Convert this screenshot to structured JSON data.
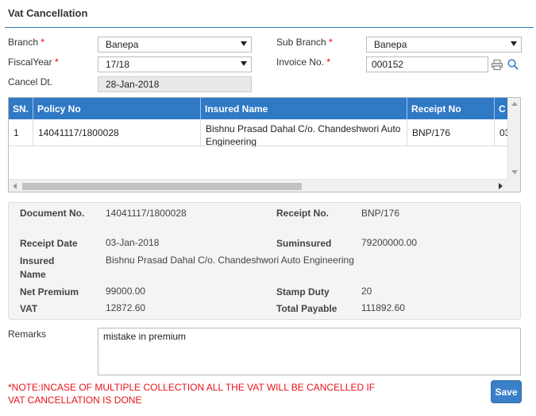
{
  "page": {
    "title": "Vat Cancellation"
  },
  "form": {
    "branch": {
      "label": "Branch",
      "required_mark": "*",
      "value": "Banepa"
    },
    "sub_branch": {
      "label": "Sub Branch",
      "required_mark": "*",
      "value": "Banepa"
    },
    "fiscal_year": {
      "label": "FiscalYear",
      "required_mark": "*",
      "value": "17/18"
    },
    "invoice_no": {
      "label": "Invoice No.",
      "required_mark": "*",
      "value": "000152"
    },
    "cancel_dt": {
      "label": "Cancel Dt.",
      "value": "28-Jan-2018"
    }
  },
  "grid": {
    "columns": [
      "SN.",
      "Policy No",
      "Insured Name",
      "Receipt No",
      "C"
    ],
    "rows": [
      {
        "sn": "1",
        "policy_no": "14041117/1800028",
        "insured_name": "Bishnu Prasad Dahal C/o. Chandeshwori Auto Engineering",
        "receipt_no": "BNP/176",
        "c": "03"
      }
    ]
  },
  "details": {
    "document_no": {
      "label": "Document No.",
      "value": "14041117/1800028"
    },
    "receipt_no": {
      "label": "Receipt No.",
      "value": "BNP/176"
    },
    "receipt_date": {
      "label": "Receipt Date",
      "value": "03-Jan-2018"
    },
    "suminsured": {
      "label": "Suminsured",
      "value": "79200000.00"
    },
    "insured_name": {
      "label": "Insured Name",
      "value": "Bishnu Prasad Dahal C/o. Chandeshwori Auto Engineering"
    },
    "net_premium": {
      "label": "Net Premium",
      "value": "99000.00"
    },
    "stamp_duty": {
      "label": "Stamp Duty",
      "value": "20"
    },
    "vat": {
      "label": "VAT",
      "value": "12872.60"
    },
    "total_payable": {
      "label": "Total Payable",
      "value": "111892.60"
    }
  },
  "remarks": {
    "label": "Remarks",
    "value": "mistake in premium"
  },
  "note": "*NOTE:INCASE OF MULTIPLE COLLECTION ALL THE VAT WILL BE CANCELLED IF VAT CANCELLATION IS DONE",
  "actions": {
    "save_label": "Save"
  },
  "colors": {
    "accent": "#2f79c5",
    "note_red": "#e8131a",
    "button": "#3a80c8"
  },
  "icons": {
    "print": "print-icon",
    "search": "search-icon"
  }
}
